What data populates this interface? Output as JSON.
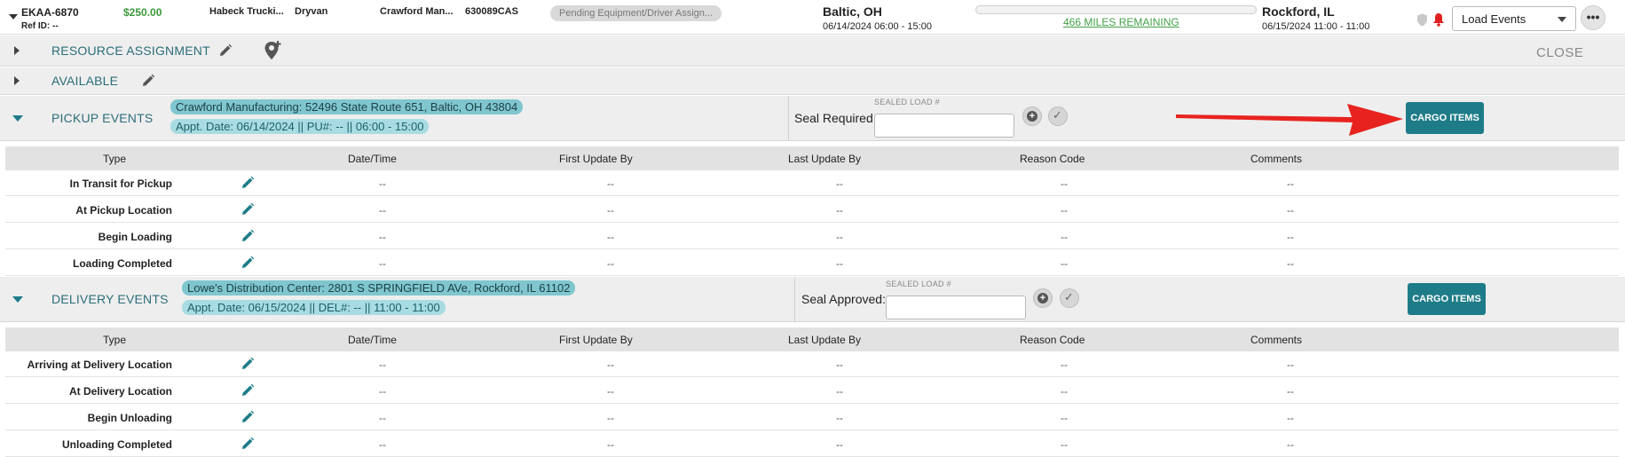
{
  "load": {
    "id": "EKAA-6870",
    "ref_id": "Ref ID: --",
    "amount": "$250.00",
    "carrier": "Habeck Trucki...",
    "equipment": "Dryvan",
    "shipper": "Crawford Man...",
    "number": "630089CAS",
    "status": "Pending Equipment/Driver Assign...",
    "origin_city": "Baltic, OH",
    "origin_window": "06/14/2024 06:00 - 15:00",
    "miles_remaining": "466 MILES REMAINING",
    "progress_fraction": 0.0,
    "dest_city": "Rockford, IL",
    "dest_window": "06/15/2024 11:00 - 11:00",
    "events_select": "Load Events",
    "more_label": "•••"
  },
  "sections": {
    "resource_assignment": "RESOURCE ASSIGNMENT",
    "available": "AVAILABLE",
    "close": "CLOSE"
  },
  "pickup": {
    "title": "PICKUP EVENTS",
    "address": "Crawford Manufacturing: 52496 State Route 651, Baltic, OH 43804",
    "appt": "Appt. Date: 06/14/2024 || PU#: -- || 06:00 - 15:00",
    "seal_label": "Seal Required:",
    "sealed_caption": "SEALED LOAD #",
    "seal_value": "",
    "cargo_button": "CARGO ITEMS",
    "rows": [
      {
        "type": "In Transit for Pickup",
        "datetime": "--",
        "first": "--",
        "last": "--",
        "reason": "--",
        "comments": "--"
      },
      {
        "type": "At Pickup Location",
        "datetime": "--",
        "first": "--",
        "last": "--",
        "reason": "--",
        "comments": "--"
      },
      {
        "type": "Begin Loading",
        "datetime": "--",
        "first": "--",
        "last": "--",
        "reason": "--",
        "comments": "--"
      },
      {
        "type": "Loading Completed",
        "datetime": "--",
        "first": "--",
        "last": "--",
        "reason": "--",
        "comments": "--"
      }
    ]
  },
  "delivery": {
    "title": "DELIVERY EVENTS",
    "address": "Lowe's Distribution Center: 2801 S SPRINGFIELD AVe, Rockford, IL 61102",
    "appt": "Appt. Date: 06/15/2024 || DEL#: -- || 11:00 - 11:00",
    "seal_label": "Seal Approved:",
    "sealed_caption": "SEALED LOAD #",
    "seal_value": "",
    "cargo_button": "CARGO ITEMS",
    "rows": [
      {
        "type": "Arriving at Delivery Location",
        "datetime": "--",
        "first": "--",
        "last": "--",
        "reason": "--",
        "comments": "--"
      },
      {
        "type": "At Delivery Location",
        "datetime": "--",
        "first": "--",
        "last": "--",
        "reason": "--",
        "comments": "--"
      },
      {
        "type": "Begin Unloading",
        "datetime": "--",
        "first": "--",
        "last": "--",
        "reason": "--",
        "comments": "--"
      },
      {
        "type": "Unloading Completed",
        "datetime": "--",
        "first": "--",
        "last": "--",
        "reason": "--",
        "comments": "--"
      }
    ]
  },
  "columns": {
    "type": "Type",
    "datetime": "Date/Time",
    "first": "First Update By",
    "last": "Last Update By",
    "reason": "Reason Code",
    "comments": "Comments"
  },
  "colors": {
    "teal": "#1e7c88",
    "alert_red": "#e02020",
    "arrow_red": "#e8231f"
  },
  "icons": {
    "edit": "pencil-icon",
    "add_driver": "location-plus-icon",
    "shield": "shield-icon",
    "bell": "bell-icon"
  }
}
